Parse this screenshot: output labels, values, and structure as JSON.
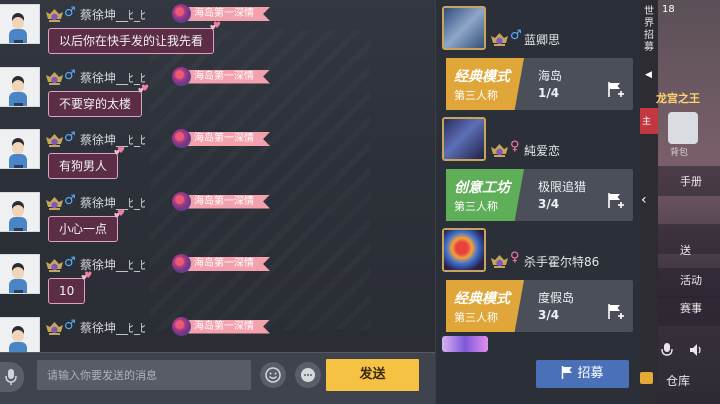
{
  "chat": {
    "messages": [
      {
        "nickname": "蔡徐坤__ﾋ_ﾋ",
        "tag": "海岛第一深情",
        "text": "以后你在快手发的让我先看"
      },
      {
        "nickname": "蔡徐坤__ﾋ_ﾋ",
        "tag": "海岛第一深情",
        "text": "不要穿的太楼"
      },
      {
        "nickname": "蔡徐坤__ﾋ_ﾋ",
        "tag": "海岛第一深情",
        "text": "有狗男人"
      },
      {
        "nickname": "蔡徐坤__ﾋ_ﾋ",
        "tag": "海岛第一深情",
        "text": "小心一点"
      },
      {
        "nickname": "蔡徐坤__ﾋ_ﾋ",
        "tag": "海岛第一深情",
        "text": "10"
      },
      {
        "nickname": "蔡徐坤__ﾋ_ﾋ",
        "tag": "海岛第一深情",
        "text": ""
      }
    ],
    "gender_male": "♂"
  },
  "input": {
    "placeholder": "请输入你要发送的消息",
    "send_label": "发送"
  },
  "recruit": {
    "items": [
      {
        "nickname": "蓝卿思",
        "gender": "♂",
        "gender_color": "#5ab0ff",
        "mode_title": "经典模式",
        "mode_sub": "第三人称",
        "mode_color": "#e0a63a",
        "map": "海岛",
        "count": "1/4"
      },
      {
        "nickname": "純爱恋",
        "gender": "♀",
        "gender_color": "#ff7aa8",
        "mode_title": "创意工坊",
        "mode_sub": "第三人称",
        "mode_color": "#5fae58",
        "map": "极限追猎",
        "count": "3/4"
      },
      {
        "nickname": "杀手霍尔特86",
        "gender": "♀",
        "gender_color": "#ff7aa8",
        "mode_title": "经典模式",
        "mode_sub": "第三人称",
        "mode_color": "#e0a63a",
        "map": "度假岛",
        "count": "3/4"
      }
    ],
    "recruit_label": "招募"
  },
  "sidebar": {
    "vertical_text": "世界招募",
    "status": "18",
    "title": "龙宫之王",
    "bag_label": "背包",
    "rows": [
      "手册",
      "送",
      "活动",
      "赛事"
    ],
    "storage_label": "仓库",
    "red_tab": "主"
  }
}
